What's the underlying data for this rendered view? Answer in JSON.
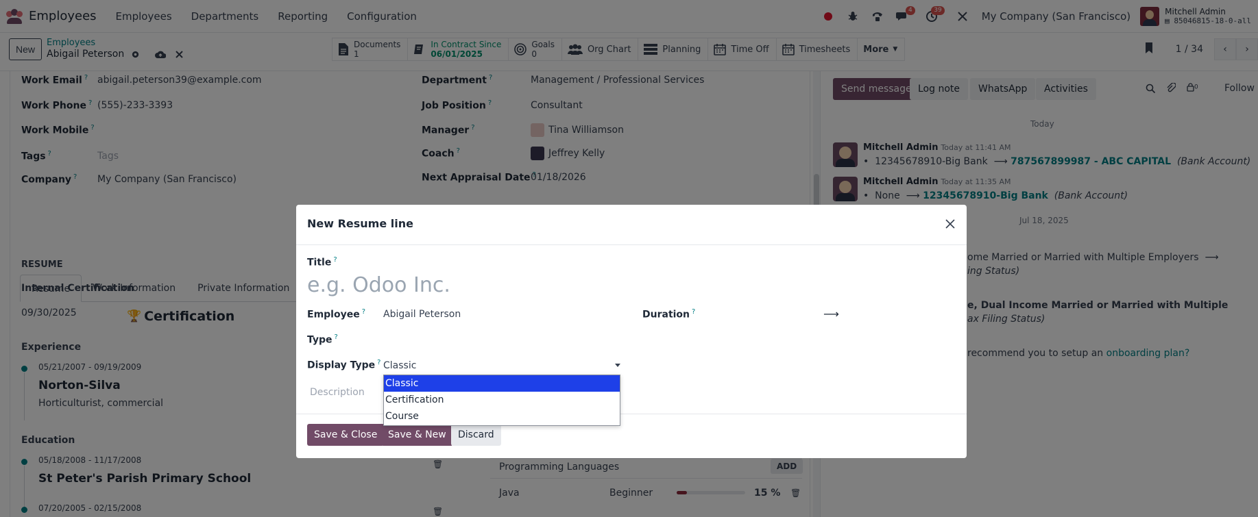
{
  "navbar": {
    "app_name": "Employees",
    "menus": [
      "Employees",
      "Departments",
      "Reporting",
      "Configuration"
    ],
    "messages_badge": "4",
    "activities_badge": "39",
    "company": "My Company (San Francisco)",
    "user_name": "Mitchell Admin",
    "db_name": "85046815-18-0-all"
  },
  "control": {
    "new_label": "New",
    "breadcrumb_parent": "Employees",
    "breadcrumb_current": "Abigail Peterson",
    "smart_buttons": [
      {
        "title": "Documents",
        "value": "1"
      },
      {
        "title": "In Contract Since",
        "value": "06/01/2025"
      },
      {
        "title": "Goals",
        "value": "0"
      },
      {
        "title": "Org Chart",
        "value": ""
      },
      {
        "title": "Planning",
        "value": ""
      },
      {
        "title": "Time Off",
        "value": ""
      },
      {
        "title": "Timesheets",
        "value": ""
      },
      {
        "title": "More",
        "value": ""
      }
    ],
    "pager": "1 / 34"
  },
  "form": {
    "work_email_label": "Work Email",
    "work_email": "abigail.peterson39@example.com",
    "work_phone_label": "Work Phone",
    "work_phone": "(555)-233-3393",
    "work_mobile_label": "Work Mobile",
    "tags_label": "Tags",
    "tags_placeholder": "Tags",
    "company_label": "Company",
    "company": "My Company (San Francisco)",
    "department_label": "Department",
    "department": "Management / Professional Services",
    "job_position_label": "Job Position",
    "job_position": "Consultant",
    "manager_label": "Manager",
    "manager": "Tina Williamson",
    "coach_label": "Coach",
    "coach": "Jeffrey Kelly",
    "appraisal_label": "Next Appraisal Date",
    "appraisal": "01/18/2026",
    "tabs": [
      "Resume",
      "Work Information",
      "Private Information"
    ],
    "resume_heading": "RESUME",
    "internal_cert_heading": "Internal Certification",
    "cert_date": "09/30/2025",
    "cert_title": "Certification",
    "experience_heading": "Experience",
    "exp_dates": "05/21/2007 - 09/19/2009",
    "exp_company": "Norton-Silva",
    "exp_desc": "Horticulturist, commercial",
    "education_heading": "Education",
    "edu1_dates": "05/18/2008 - 11/17/2008",
    "edu1_school": "St Peter's Parish Primary School",
    "edu2_dates": "07/20/2005 - 02/15/2008",
    "skills_heading": "Programming Languages",
    "skills_add": "ADD",
    "skill_name": "Java",
    "skill_level": "Beginner",
    "skill_percent": "15 %",
    "skill_progress": 15
  },
  "chatter": {
    "send_message": "Send message",
    "log_note": "Log note",
    "whatsapp": "WhatsApp",
    "activities": "Activities",
    "follower_count": "0",
    "follow": "Follow",
    "today": "Today",
    "msg1_author": "Mitchell Admin",
    "msg1_time": "Today at 11:41 AM",
    "msg1_old": "12345678910-Big Bank",
    "msg1_new": "787567899987 - ABC CAPITAL",
    "msg1_field": "(Bank Account)",
    "msg2_author": "Mitchell Admin",
    "msg2_time": "Today at 11:35 AM",
    "msg2_old": "None",
    "msg2_new": "12345678910-Big Bank",
    "msg2_field": "(Bank Account)",
    "date2": "Jul 18, 2025",
    "frag1": "ome Married or Married with Multiple Employers",
    "frag2": "ing Status)",
    "frag3": "e, Dual Income Married or Married with Multiple",
    "frag4": "ax Filing Status)",
    "frag5_a": "recommend you to setup an ",
    "frag5_link": "onboarding plan?"
  },
  "modal": {
    "title": "New Resume line",
    "title_label": "Title",
    "title_placeholder": "e.g. Odoo Inc.",
    "employee_label": "Employee",
    "employee": "Abigail Peterson",
    "duration_label": "Duration",
    "type_label": "Type",
    "display_type_label": "Display Type",
    "display_type_value": "Classic",
    "options": [
      "Classic",
      "Certification",
      "Course"
    ],
    "description_placeholder": "Description",
    "save_close": "Save & Close",
    "save_new": "Save & New",
    "discard": "Discard"
  },
  "colors": {
    "brand": "#714b67",
    "link": "#017e84",
    "selected_option": "#1e40e8"
  }
}
